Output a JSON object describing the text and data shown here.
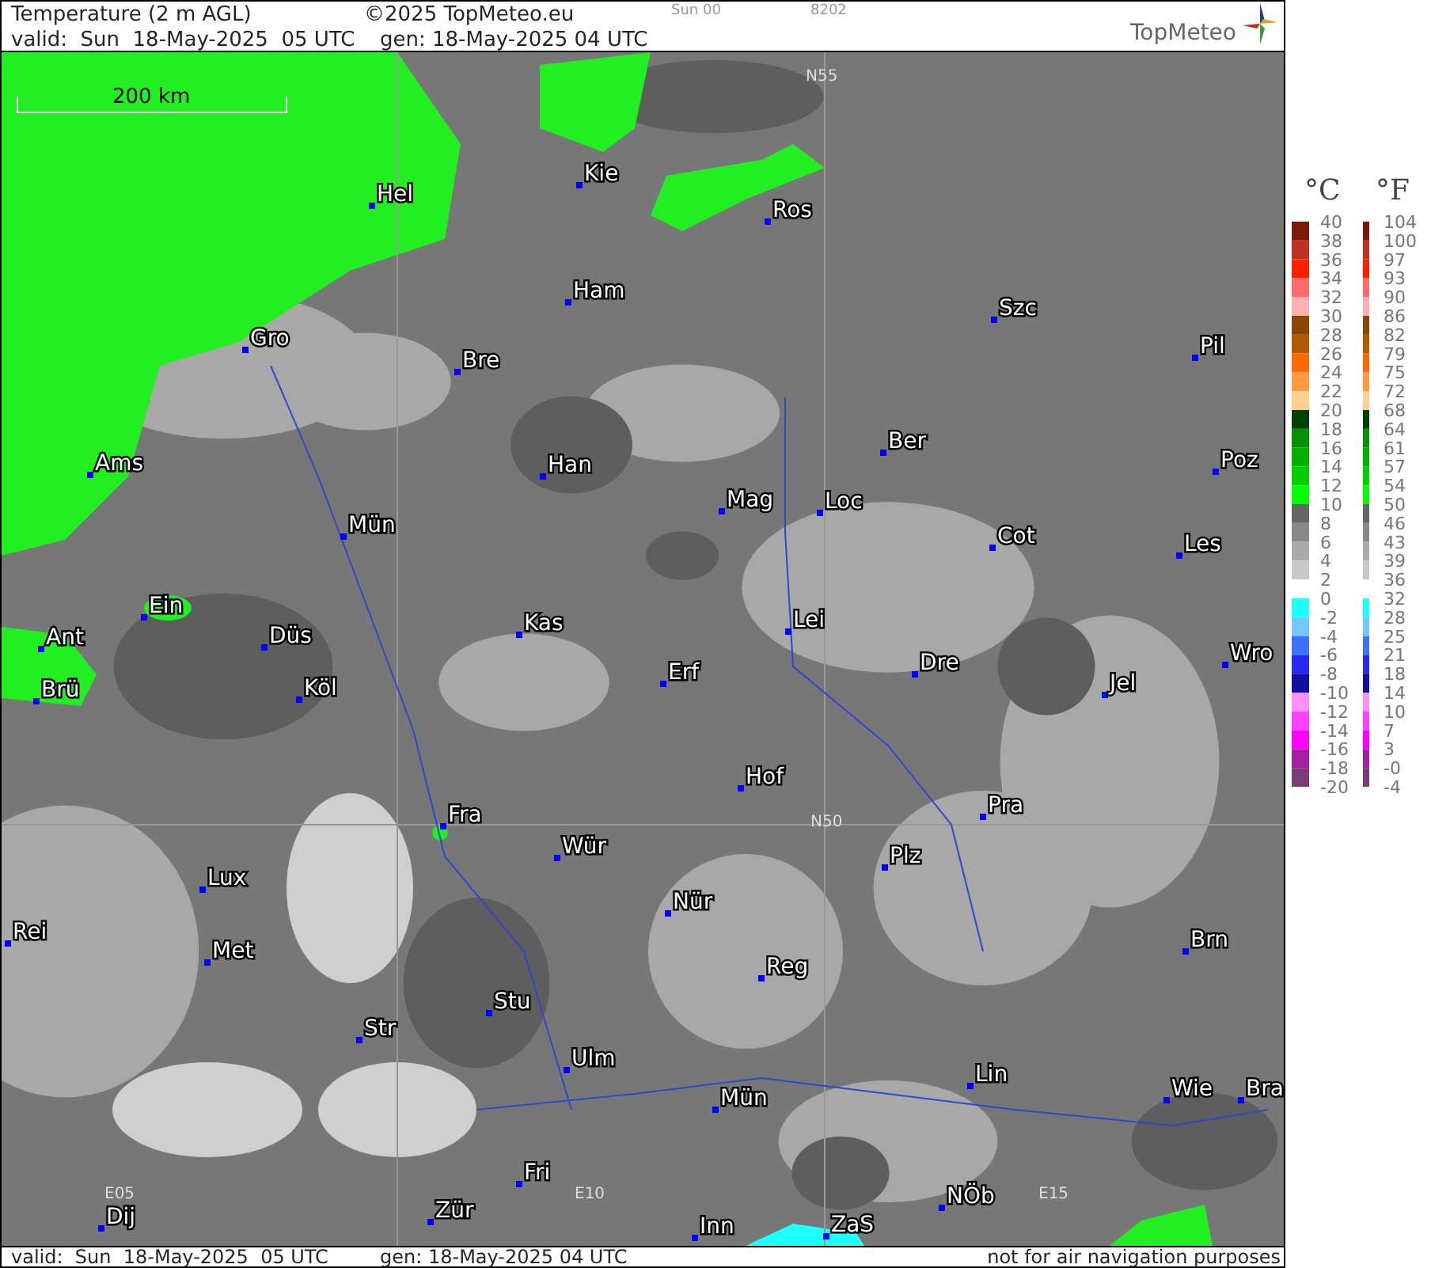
{
  "header": {
    "title": "Temperature (2 m AGL)",
    "copyright": "©2025 TopMeteo.eu",
    "run": "Sun 00",
    "code": "8202",
    "valid": "valid:  Sun  18-May-2025  05 UTC",
    "generated": "gen: 18-May-2025 04 UTC",
    "logo": "TopMeteo"
  },
  "map": {
    "scale_bar": "200 km",
    "grid_labels": [
      "N55",
      "N50",
      "E05",
      "E10",
      "E15"
    ],
    "cities": [
      "Hel",
      "Kie",
      "Ros",
      "Ham",
      "Gro",
      "Bre",
      "Szc",
      "Pil",
      "Ams",
      "Han",
      "Ber",
      "Mag",
      "Loc",
      "Poz",
      "Mün",
      "Cot",
      "Les",
      "Ein",
      "Ant",
      "Kas",
      "Lei",
      "Düs",
      "Wro",
      "Brü",
      "Köl",
      "Erf",
      "Dre",
      "Jel",
      "Hof",
      "Fra",
      "Pra",
      "Wür",
      "Plz",
      "Lux",
      "Nür",
      "Rei",
      "Met",
      "Brn",
      "Reg",
      "Stu",
      "Str",
      "Ulm",
      "Lin",
      "Mün",
      "Wie",
      "Bra",
      "Fri",
      "Dij",
      "Zür",
      "NÖb",
      "Inn",
      "ZaS"
    ]
  },
  "legend": {
    "celsius_unit": "°C",
    "fahrenheit_unit": "°F",
    "celsius_labels": [
      "40",
      "38",
      "36",
      "34",
      "32",
      "30",
      "28",
      "26",
      "24",
      "22",
      "20",
      "18",
      "16",
      "14",
      "12",
      "10",
      "8",
      "6",
      "4",
      "2",
      "0",
      "-2",
      "-4",
      "-6",
      "-8",
      "-10",
      "-12",
      "-14",
      "-16",
      "-18",
      "-20"
    ],
    "fahrenheit_labels": [
      "104",
      "100",
      "97",
      "93",
      "90",
      "86",
      "82",
      "79",
      "75",
      "72",
      "68",
      "64",
      "61",
      "57",
      "54",
      "50",
      "46",
      "43",
      "39",
      "36",
      "32",
      "28",
      "25",
      "21",
      "18",
      "14",
      "10",
      "7",
      "3",
      "-0",
      "-4"
    ],
    "swatches": [
      {
        "color": "#7a1a0a"
      },
      {
        "color": "#c03020"
      },
      {
        "color": "#ff2000"
      },
      {
        "color": "#ff6a6a"
      },
      {
        "color": "#ffb0b0"
      },
      {
        "color": "#8b4500"
      },
      {
        "color": "#b05a00"
      },
      {
        "color": "#ff6a00"
      },
      {
        "color": "#ff9a40"
      },
      {
        "color": "#ffd090"
      },
      {
        "color": "#004000"
      },
      {
        "color": "#009000"
      },
      {
        "color": "#00b000"
      },
      {
        "color": "#00d000"
      },
      {
        "color": "#00ff00"
      },
      {
        "color": "#666666"
      },
      {
        "color": "#888888"
      },
      {
        "color": "#aaaaaa"
      },
      {
        "color": "#c8c8c8"
      },
      {
        "color": "#ffffff"
      },
      {
        "color": "#20ffff"
      },
      {
        "color": "#70c8ff"
      },
      {
        "color": "#4070ff"
      },
      {
        "color": "#2828f0"
      },
      {
        "color": "#1010a0"
      },
      {
        "color": "#ff90ff"
      },
      {
        "color": "#ff40ff"
      },
      {
        "color": "#ff00ff"
      },
      {
        "color": "#a020a0"
      },
      {
        "color": "#7a3c78"
      }
    ]
  },
  "footer": {
    "valid": "valid:  Sun  18-May-2025  05 UTC",
    "generated": "gen: 18-May-2025 04 UTC",
    "disclaimer": "not for air navigation purposes"
  }
}
